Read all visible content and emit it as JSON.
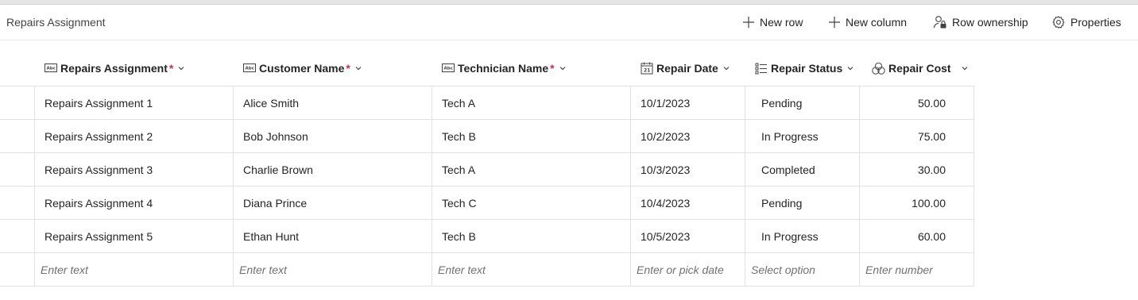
{
  "header": {
    "title": "Repairs Assignment",
    "new_row": "New row",
    "new_column": "New column",
    "row_ownership": "Row ownership",
    "properties": "Properties"
  },
  "columns": [
    {
      "label": "Repairs Assignment",
      "required": "*",
      "icon": "text-field-icon"
    },
    {
      "label": "Customer Name",
      "required": "*",
      "icon": "text-field-icon"
    },
    {
      "label": "Technician Name",
      "required": "*",
      "icon": "text-field-icon"
    },
    {
      "label": "Repair Date",
      "icon": "calendar-icon"
    },
    {
      "label": "Repair Status",
      "icon": "choice-list-icon"
    },
    {
      "label": "Repair Cost",
      "icon": "currency-icon"
    }
  ],
  "rows": [
    [
      "Repairs Assignment 1",
      "Alice Smith",
      "Tech A",
      "10/1/2023",
      "Pending",
      "50.00"
    ],
    [
      "Repairs Assignment 2",
      "Bob Johnson",
      "Tech B",
      "10/2/2023",
      "In Progress",
      "75.00"
    ],
    [
      "Repairs Assignment 3",
      "Charlie Brown",
      "Tech A",
      "10/3/2023",
      "Completed",
      "30.00"
    ],
    [
      "Repairs Assignment 4",
      "Diana Prince",
      "Tech C",
      "10/4/2023",
      "Pending",
      "100.00"
    ],
    [
      "Repairs Assignment 5",
      "Ethan Hunt",
      "Tech B",
      "10/5/2023",
      "In Progress",
      "60.00"
    ]
  ],
  "new_row_placeholders": [
    "Enter text",
    "Enter text",
    "Enter text",
    "Enter or pick date",
    "Select option",
    "Enter number"
  ],
  "colors": {
    "required": "#c4314b",
    "gridline": "#e1e1e1",
    "placeholder": "#707070"
  }
}
